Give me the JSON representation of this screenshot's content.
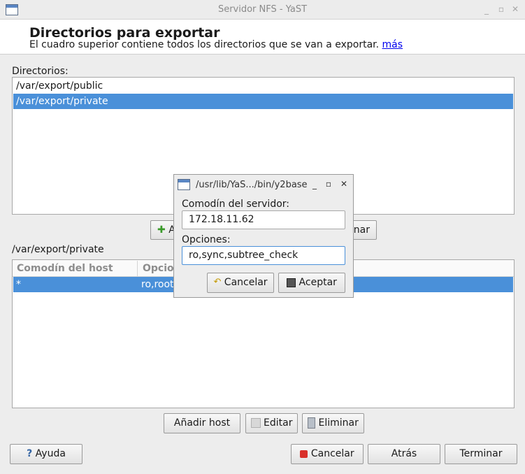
{
  "window": {
    "title": "Servidor NFS - YaST"
  },
  "header": {
    "title": "Directorios para exportar",
    "description": "El cuadro superior contiene todos los directorios que se van a exportar.",
    "more_link": "más"
  },
  "directories": {
    "label": "Directorios:",
    "items": [
      "/var/export/public",
      "/var/export/private"
    ],
    "selected_index": 1,
    "buttons": {
      "add_partial": "A",
      "delete_partial": "inar"
    }
  },
  "hosts": {
    "label": "/var/export/private",
    "columns": [
      "Comodín del host",
      "Opcio"
    ],
    "rows": [
      {
        "host": "*",
        "options": "ro,root"
      }
    ],
    "buttons": {
      "add": "Añadir host",
      "edit": "Editar",
      "delete": "Eliminar"
    }
  },
  "footer": {
    "help": "Ayuda",
    "cancel": "Cancelar",
    "back": "Atrás",
    "finish": "Terminar"
  },
  "dialog": {
    "title": "/usr/lib/YaS.../bin/y2base",
    "wildcard_label": "Comodín del servidor:",
    "wildcard_value": "172.18.11.62",
    "options_label": "Opciones:",
    "options_value": "ro,sync,subtree_check",
    "cancel": "Cancelar",
    "accept": "Aceptar"
  },
  "colors": {
    "selection": "#4a90d9",
    "stop": "#d9302a"
  },
  "icons": [
    "window-icon",
    "minimize-icon",
    "maximize-icon",
    "close-icon",
    "add-icon",
    "help-icon",
    "cancel-icon",
    "edit-icon",
    "delete-icon",
    "undo-icon",
    "save-icon"
  ]
}
